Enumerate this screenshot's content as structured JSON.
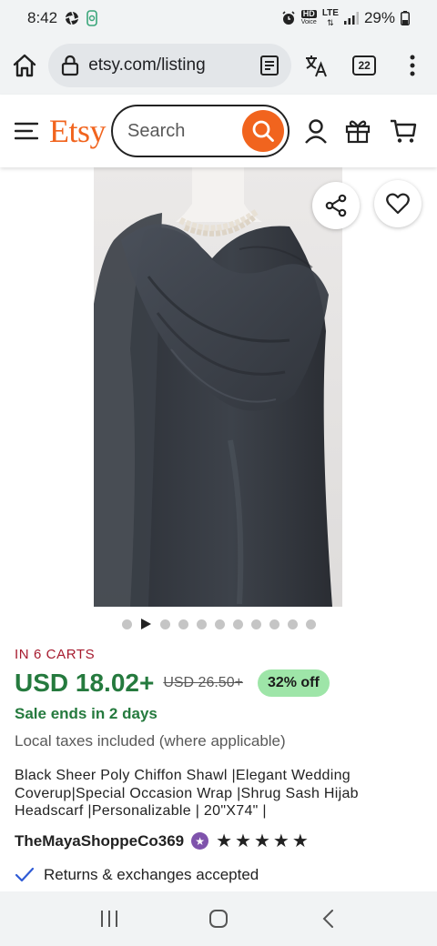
{
  "status_bar": {
    "time": "8:42",
    "battery": "29%",
    "network": "LTE",
    "voice": "HD"
  },
  "browser": {
    "url": "etsy.com/listing",
    "tab_count": "22"
  },
  "header": {
    "logo": "Etsy",
    "search_placeholder": "Search"
  },
  "listing": {
    "in_carts": "IN 6 CARTS",
    "price": "USD 18.02+",
    "original_price": "USD 26.50+",
    "discount": "32% off",
    "sale_ends": "Sale ends in 2 days",
    "taxes": "Local taxes included (where applicable)",
    "title": "Black Sheer Poly Chiffon Shawl |Elegant Wedding Coverup|Special Occasion Wrap |Shrug Sash Hijab Headscarf |Personalizable | 20\"X74\" |",
    "shop_name": "TheMayaShoppeCo369",
    "rating_stars": 5,
    "returns": "Returns & exchanges accepted"
  },
  "carousel": {
    "total_images": 11,
    "active_index": 1
  },
  "colors": {
    "etsy_orange": "#F1641E",
    "price_green": "#257A3E",
    "carts_red": "#A61A2E",
    "discount_bg": "#9EE5A8",
    "star_seller_purple": "#7F53AC"
  }
}
